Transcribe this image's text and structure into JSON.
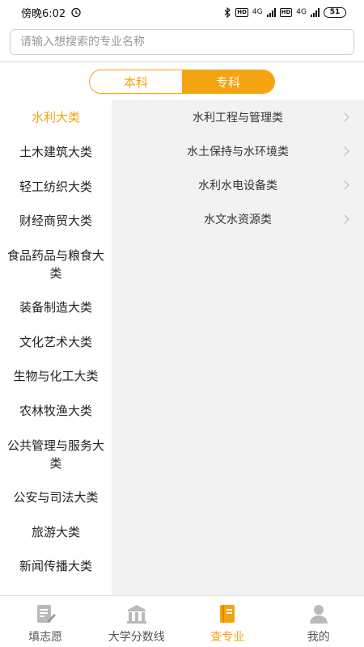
{
  "status_bar": {
    "time": "傍晚6:02",
    "network_left": "4G",
    "network_right": "4G",
    "battery": "51"
  },
  "search": {
    "placeholder": "请输入想搜索的专业名称",
    "value": ""
  },
  "segment": {
    "tabs": [
      {
        "label": "本科",
        "active": false
      },
      {
        "label": "专科",
        "active": true
      }
    ]
  },
  "categories": {
    "selected_index": 0,
    "items": [
      {
        "label": "水利大类"
      },
      {
        "label": "土木建筑大类"
      },
      {
        "label": "轻工纺织大类"
      },
      {
        "label": "财经商贸大类"
      },
      {
        "label": "食品药品与粮食大类"
      },
      {
        "label": "装备制造大类"
      },
      {
        "label": "文化艺术大类"
      },
      {
        "label": "生物与化工大类"
      },
      {
        "label": "农林牧渔大类"
      },
      {
        "label": "公共管理与服务大类"
      },
      {
        "label": "公安与司法大类"
      },
      {
        "label": "旅游大类"
      },
      {
        "label": "新闻传播大类"
      }
    ]
  },
  "subcategories": {
    "items": [
      {
        "label": "水利工程与管理类"
      },
      {
        "label": "水土保持与水环境类"
      },
      {
        "label": "水利水电设备类"
      },
      {
        "label": "水文水资源类"
      }
    ]
  },
  "bottom_nav": {
    "items": [
      {
        "label": "填志愿",
        "icon": "edit-icon",
        "active": false
      },
      {
        "label": "大学分数线",
        "icon": "school-icon",
        "active": false
      },
      {
        "label": "查专业",
        "icon": "book-icon",
        "active": true
      },
      {
        "label": "我的",
        "icon": "user-icon",
        "active": false
      }
    ]
  },
  "colors": {
    "accent": "#f5a310",
    "panel_bg": "#f2f2f2",
    "icon_inactive": "#b9b9b9"
  }
}
